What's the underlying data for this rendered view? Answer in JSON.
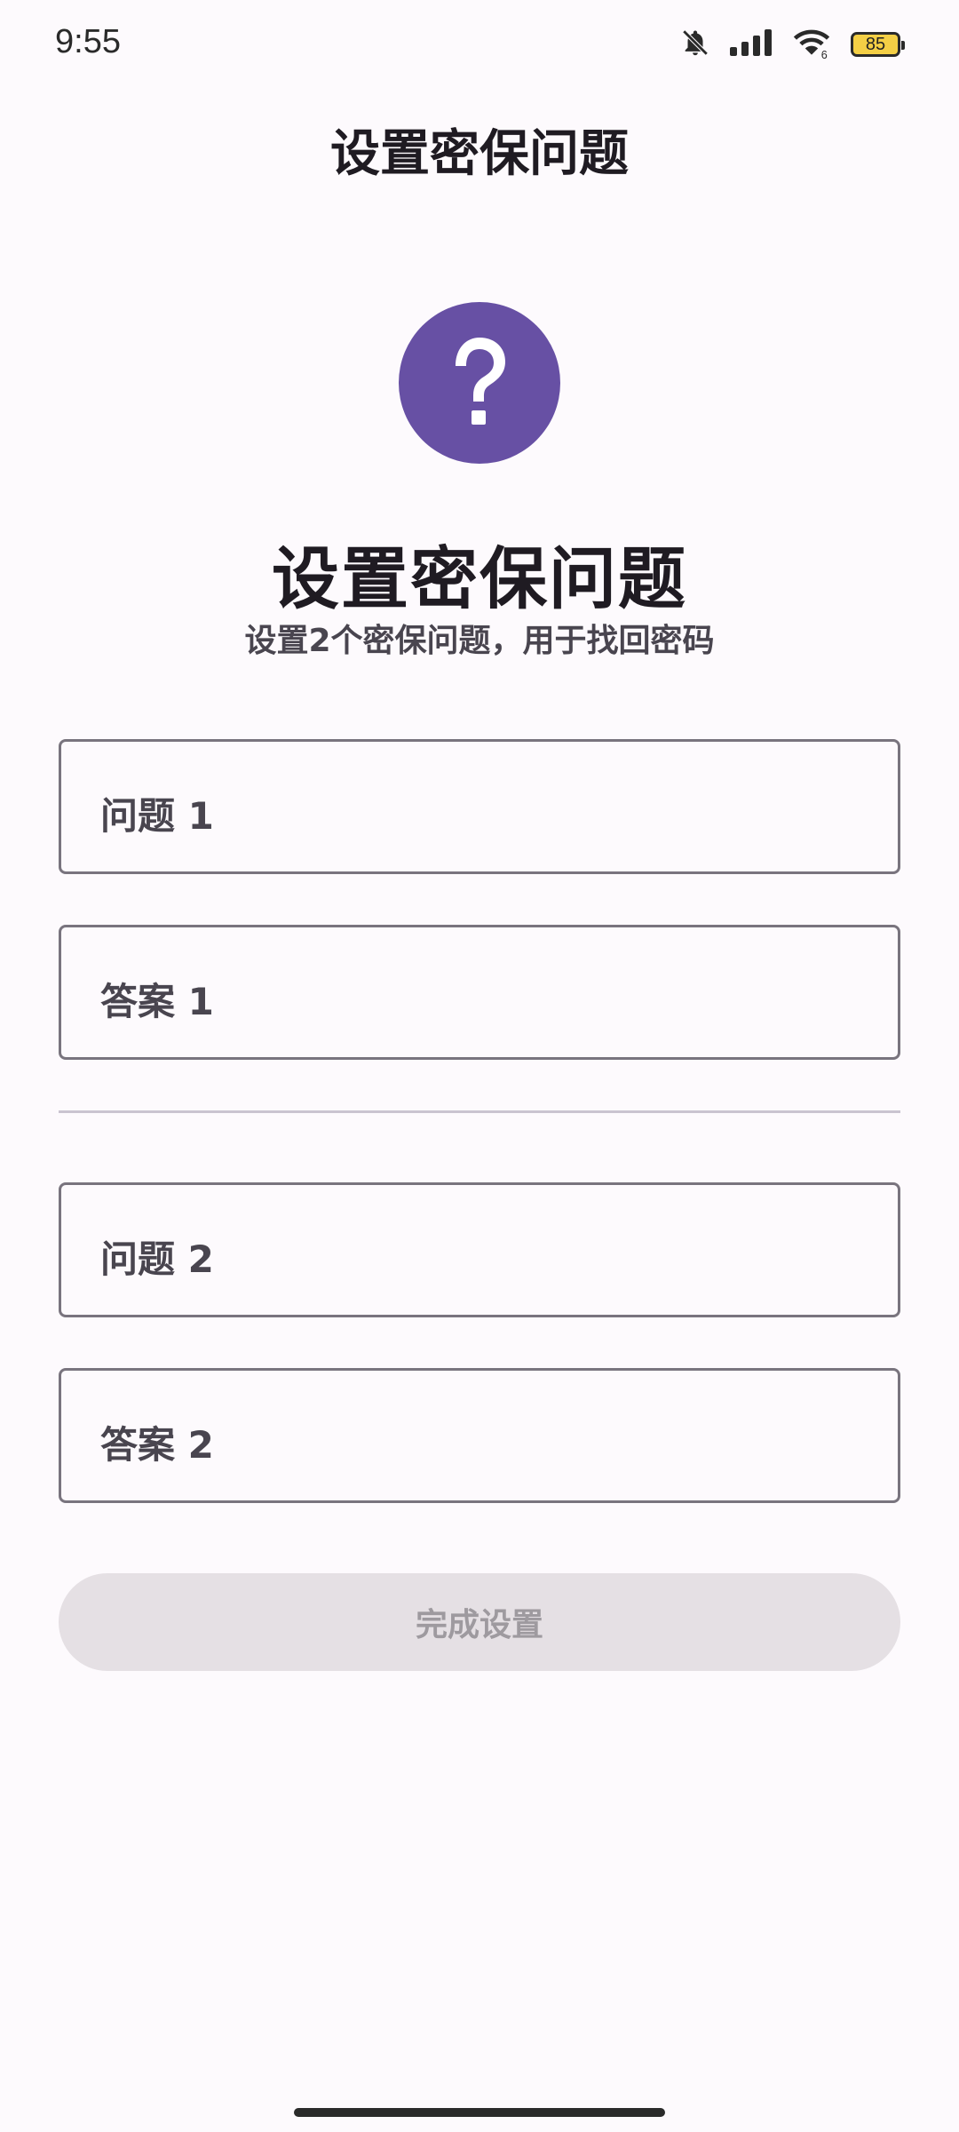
{
  "status_bar": {
    "time": "9:55",
    "battery_level": "85",
    "icons": [
      "bell-off-icon",
      "signal-icon",
      "wifi-icon",
      "battery-icon"
    ]
  },
  "app_bar": {
    "title": "设置密保问题"
  },
  "hero": {
    "icon": "help-circle-icon",
    "icon_color": "#6750a4",
    "heading": "设置密保问题",
    "subheading": "设置2个密保问题，用于找回密码"
  },
  "form": {
    "question1": {
      "label": "问题 1",
      "value": ""
    },
    "answer1": {
      "label": "答案 1",
      "value": ""
    },
    "question2": {
      "label": "问题 2",
      "value": ""
    },
    "answer2": {
      "label": "答案 2",
      "value": ""
    }
  },
  "submit": {
    "label": "完成设置",
    "enabled": false
  }
}
